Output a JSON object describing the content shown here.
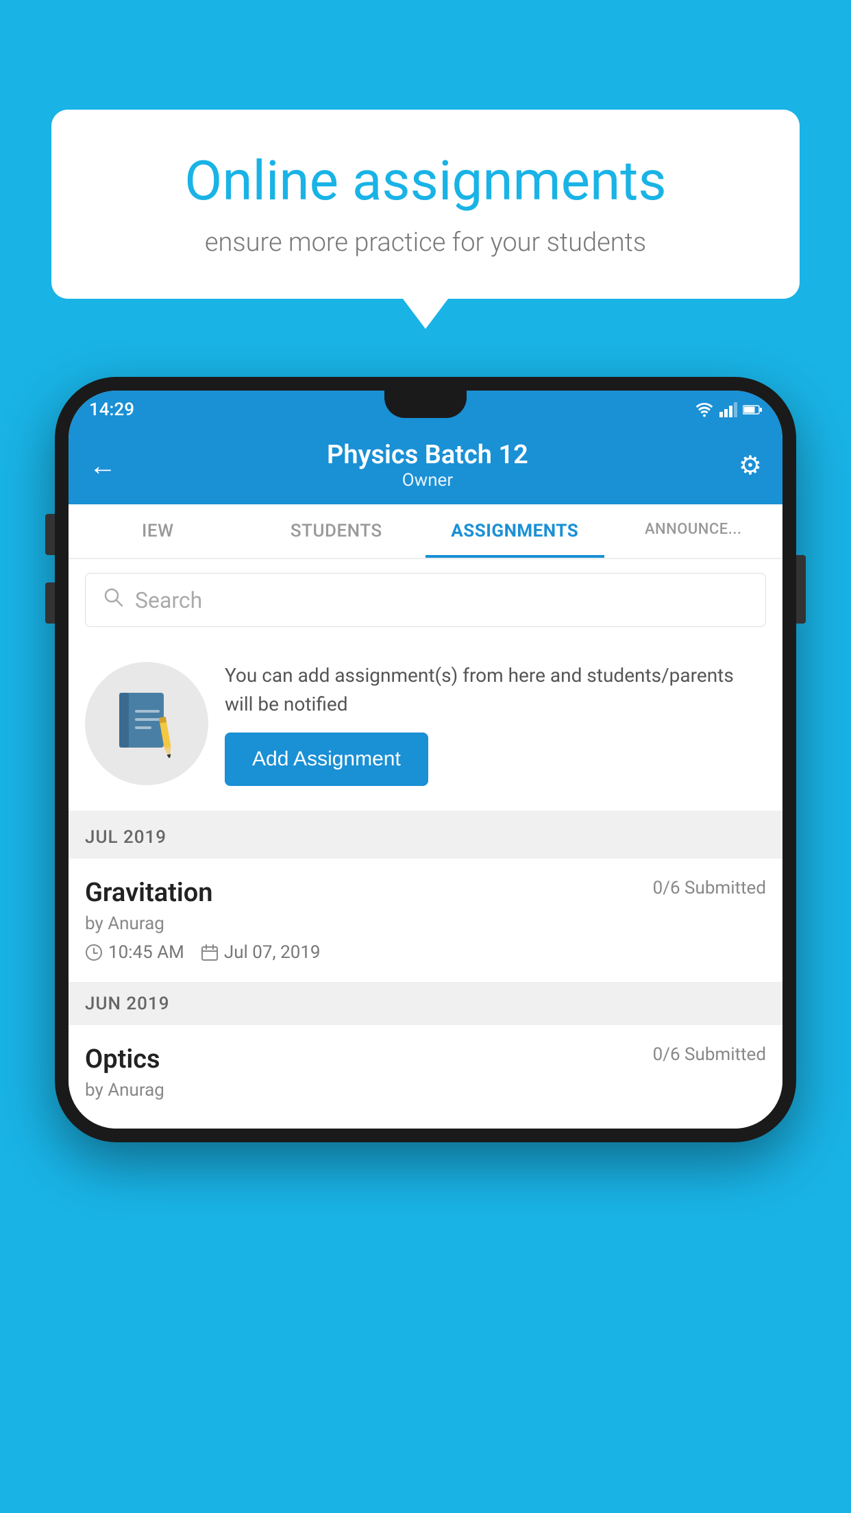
{
  "background": {
    "color": "#19B3E6"
  },
  "speech_bubble": {
    "title": "Online assignments",
    "subtitle": "ensure more practice for your students"
  },
  "phone": {
    "status_bar": {
      "time": "14:29",
      "wifi": "wifi",
      "signal": "signal",
      "battery": "battery"
    },
    "header": {
      "back_label": "←",
      "batch_name": "Physics Batch 12",
      "owner_label": "Owner",
      "settings_label": "⚙"
    },
    "tabs": [
      {
        "id": "iew",
        "label": "IEW",
        "active": false
      },
      {
        "id": "students",
        "label": "STUDENTS",
        "active": false
      },
      {
        "id": "assignments",
        "label": "ASSIGNMENTS",
        "active": true
      },
      {
        "id": "announcements",
        "label": "ANNOUNCEMENTS",
        "active": false
      }
    ],
    "search": {
      "placeholder": "Search"
    },
    "promo": {
      "description": "You can add assignment(s) from here and students/parents will be notified",
      "button_label": "Add Assignment"
    },
    "assignment_sections": [
      {
        "month": "JUL 2019",
        "assignments": [
          {
            "name": "Gravitation",
            "submitted": "0/6 Submitted",
            "author": "by Anurag",
            "time": "10:45 AM",
            "date": "Jul 07, 2019"
          }
        ]
      },
      {
        "month": "JUN 2019",
        "assignments": [
          {
            "name": "Optics",
            "submitted": "0/6 Submitted",
            "author": "by Anurag",
            "time": "",
            "date": ""
          }
        ]
      }
    ]
  }
}
